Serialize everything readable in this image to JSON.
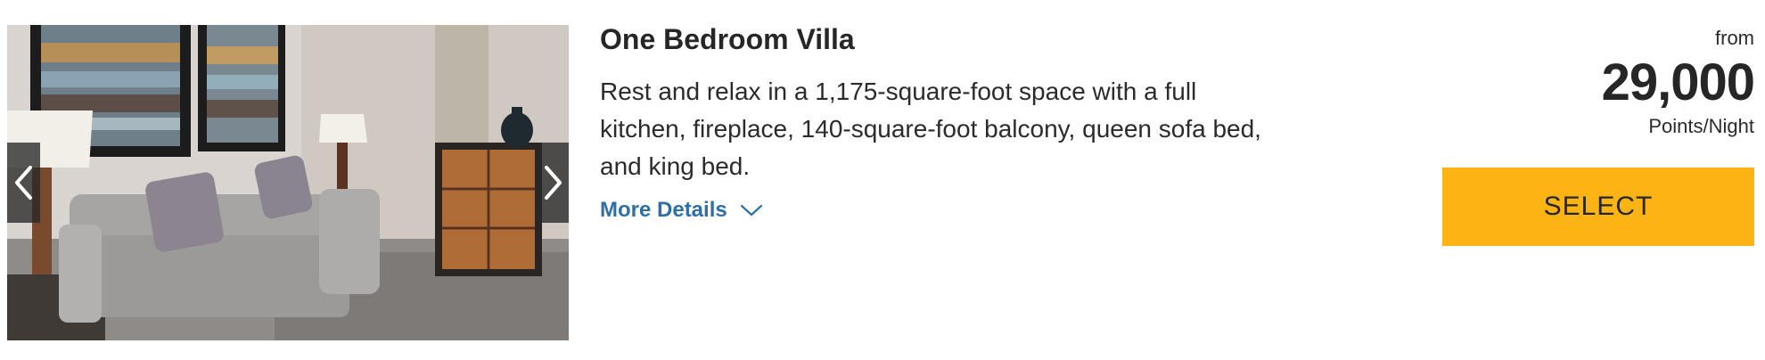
{
  "room": {
    "title": "One Bedroom Villa",
    "description": "Rest and relax in a 1,175-square-foot space with a full kitchen, fireplace, 140-square-foot balcony, queen sofa bed, and king bed.",
    "more_details_label": "More Details",
    "image_alt": "One Bedroom Villa living room with sofa, lamps, and artwork"
  },
  "rate": {
    "from_label": "from",
    "points": "29,000",
    "unit_label": "Points/Night",
    "select_label": "SELECT"
  },
  "colors": {
    "accent_button": "#fbb414",
    "link": "#2f6fa7"
  },
  "icons": {
    "prev": "chevron-left-icon",
    "next": "chevron-right-icon",
    "more": "chevron-down-icon"
  }
}
